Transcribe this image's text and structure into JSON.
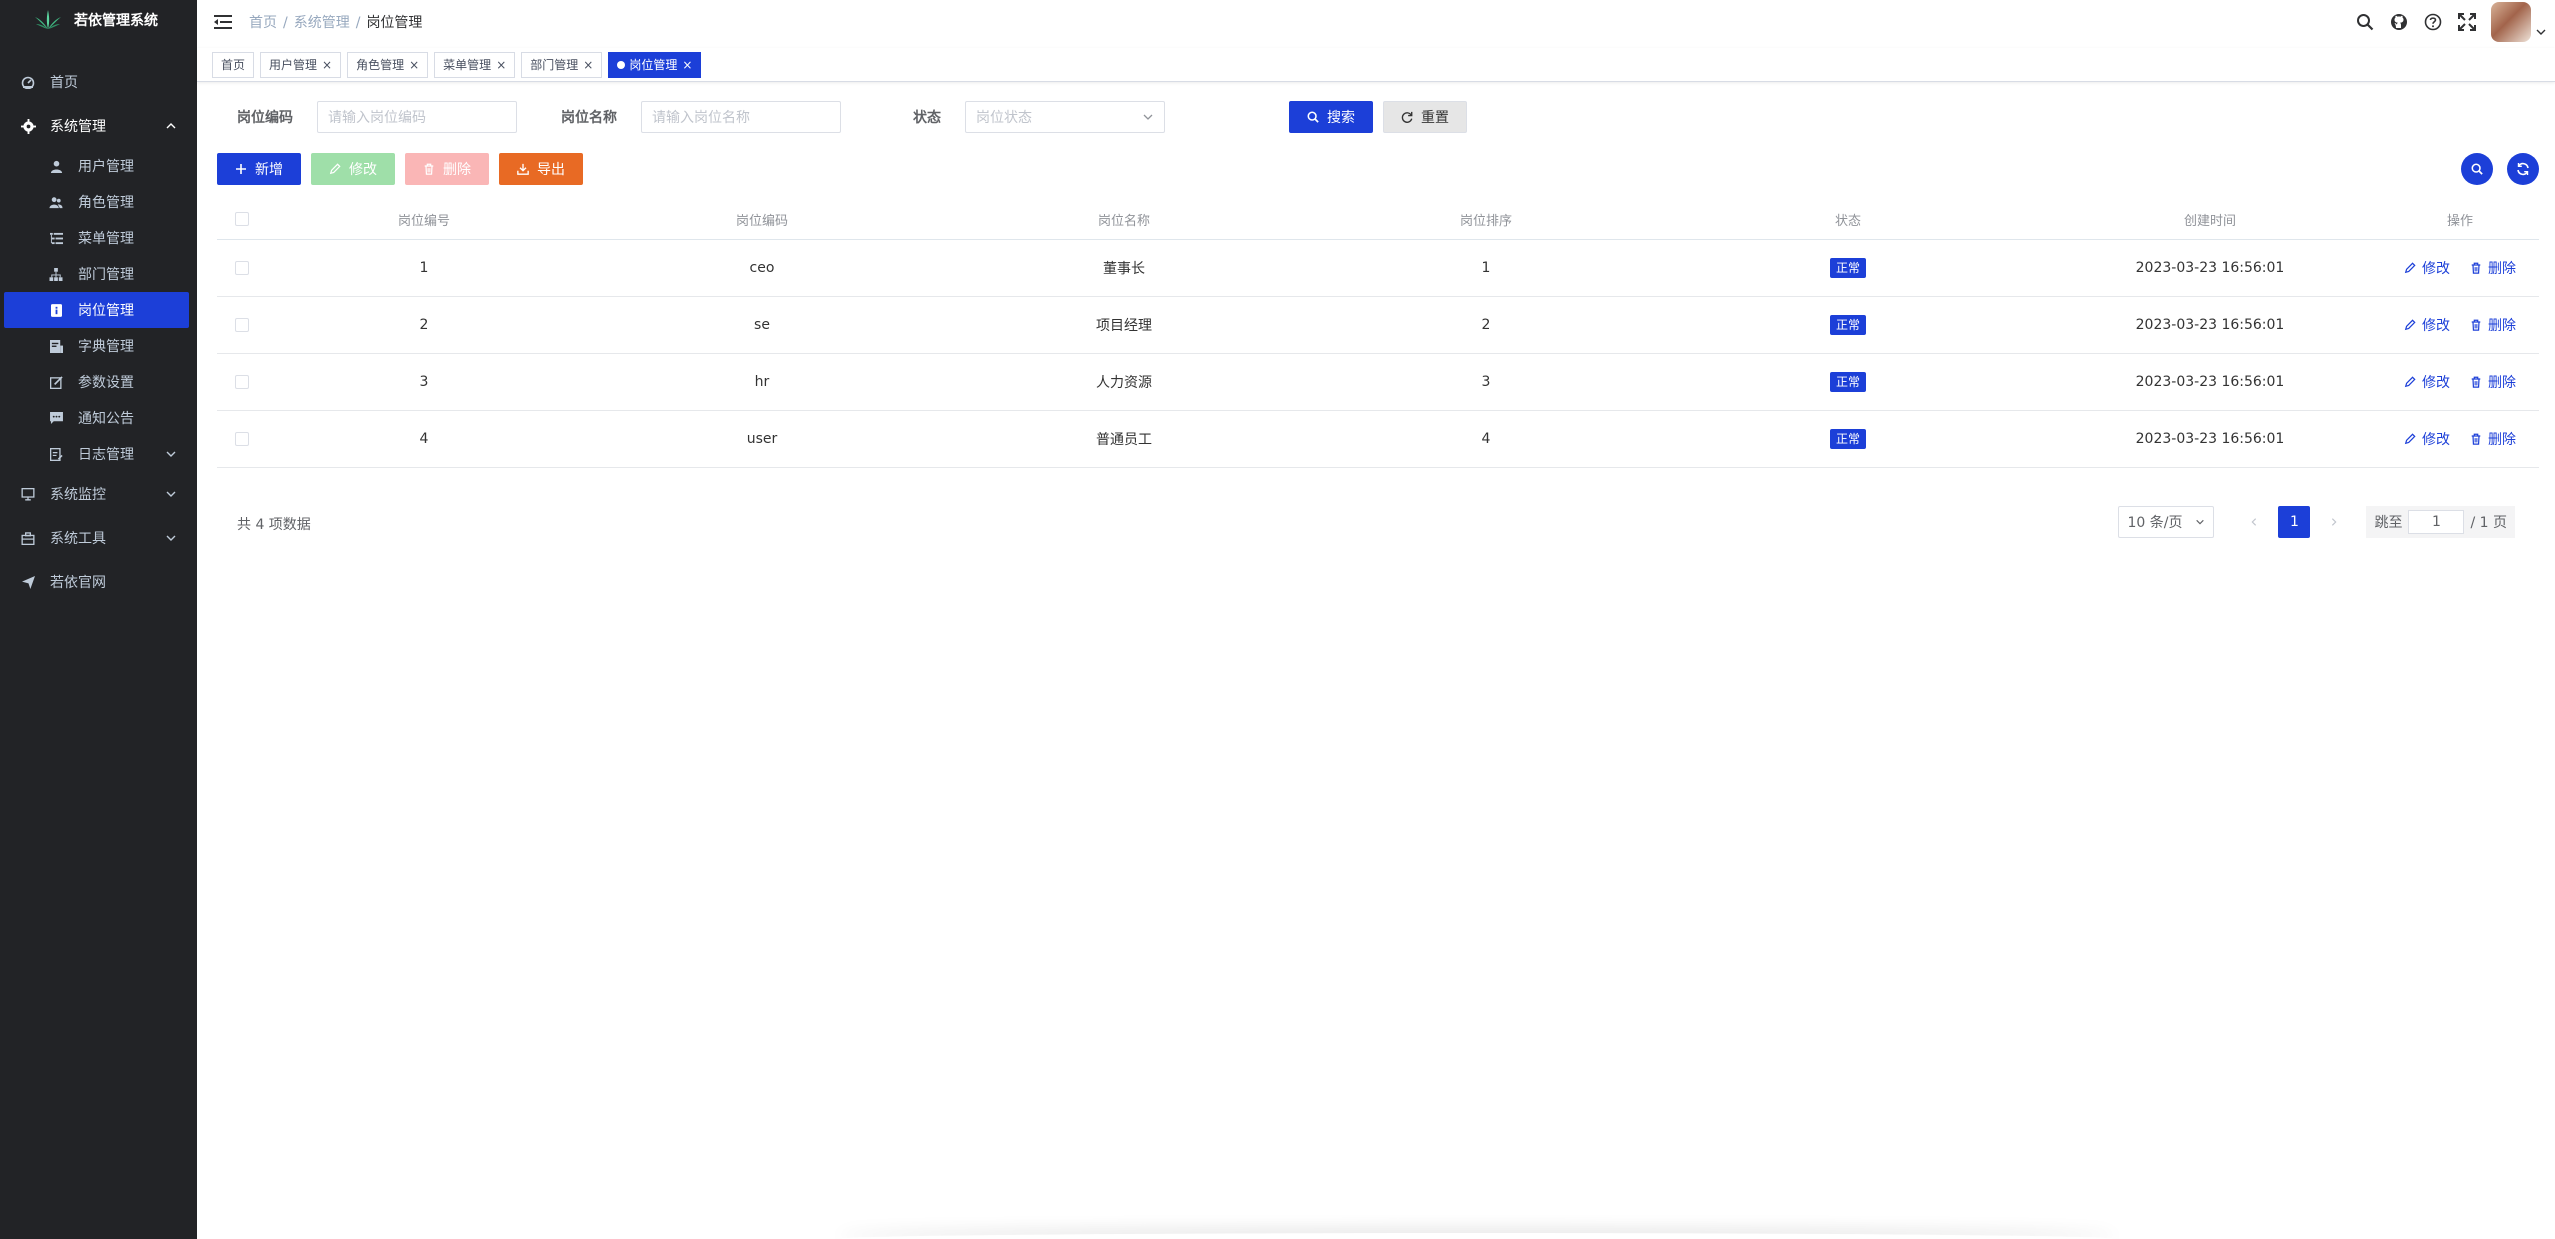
{
  "app": {
    "title": "若依管理系统"
  },
  "sidebar": {
    "items": [
      {
        "label": "首页",
        "icon": "dashboard-icon"
      },
      {
        "label": "系统管理",
        "icon": "gear-icon",
        "expanded": true
      },
      {
        "label": "用户管理",
        "icon": "user-icon"
      },
      {
        "label": "角色管理",
        "icon": "peoples-icon"
      },
      {
        "label": "菜单管理",
        "icon": "tree-table-icon"
      },
      {
        "label": "部门管理",
        "icon": "tree-icon"
      },
      {
        "label": "岗位管理",
        "icon": "post-icon",
        "active": true
      },
      {
        "label": "字典管理",
        "icon": "dict-icon"
      },
      {
        "label": "参数设置",
        "icon": "edit-icon"
      },
      {
        "label": "通知公告",
        "icon": "message-icon"
      },
      {
        "label": "日志管理",
        "icon": "log-icon"
      },
      {
        "label": "系统监控",
        "icon": "monitor-icon"
      },
      {
        "label": "系统工具",
        "icon": "tool-icon"
      },
      {
        "label": "若依官网",
        "icon": "guide-icon"
      }
    ]
  },
  "breadcrumb": {
    "items": [
      "首页",
      "系统管理",
      "岗位管理"
    ],
    "sep": "/"
  },
  "tags": [
    {
      "label": "首页"
    },
    {
      "label": "用户管理",
      "close": "×"
    },
    {
      "label": "角色管理",
      "close": "×"
    },
    {
      "label": "菜单管理",
      "close": "×"
    },
    {
      "label": "部门管理",
      "close": "×"
    },
    {
      "label": "岗位管理",
      "close": "×",
      "active": true
    }
  ],
  "search": {
    "code_label": "岗位编码",
    "code_placeholder": "请输入岗位编码",
    "name_label": "岗位名称",
    "name_placeholder": "请输入岗位名称",
    "status_label": "状态",
    "status_placeholder": "岗位状态",
    "search_button": "搜索",
    "reset_button": "重置"
  },
  "toolbar": {
    "add": "新增",
    "edit": "修改",
    "delete": "删除",
    "export": "导出"
  },
  "table": {
    "headers": [
      "岗位编号",
      "岗位编码",
      "岗位名称",
      "岗位排序",
      "状态",
      "创建时间",
      "操作"
    ],
    "rows": [
      {
        "id": "1",
        "code": "ceo",
        "name": "董事长",
        "sort": "1",
        "status": "正常",
        "time": "2023-03-23 16:56:01"
      },
      {
        "id": "2",
        "code": "se",
        "name": "项目经理",
        "sort": "2",
        "status": "正常",
        "time": "2023-03-23 16:56:01"
      },
      {
        "id": "3",
        "code": "hr",
        "name": "人力资源",
        "sort": "3",
        "status": "正常",
        "time": "2023-03-23 16:56:01"
      },
      {
        "id": "4",
        "code": "user",
        "name": "普通员工",
        "sort": "4",
        "status": "正常",
        "time": "2023-03-23 16:56:01"
      }
    ],
    "op_edit": "修改",
    "op_delete": "删除"
  },
  "pagination": {
    "total": "共 4 项数据",
    "page_size": "10 条/页",
    "current": "1",
    "jump_label": "跳至",
    "jump_value": "1",
    "pages_label": "/ 1 页"
  },
  "colors": {
    "primary": "#1c3fd8",
    "sidebar_bg": "#222326",
    "warning": "#e86a24"
  }
}
